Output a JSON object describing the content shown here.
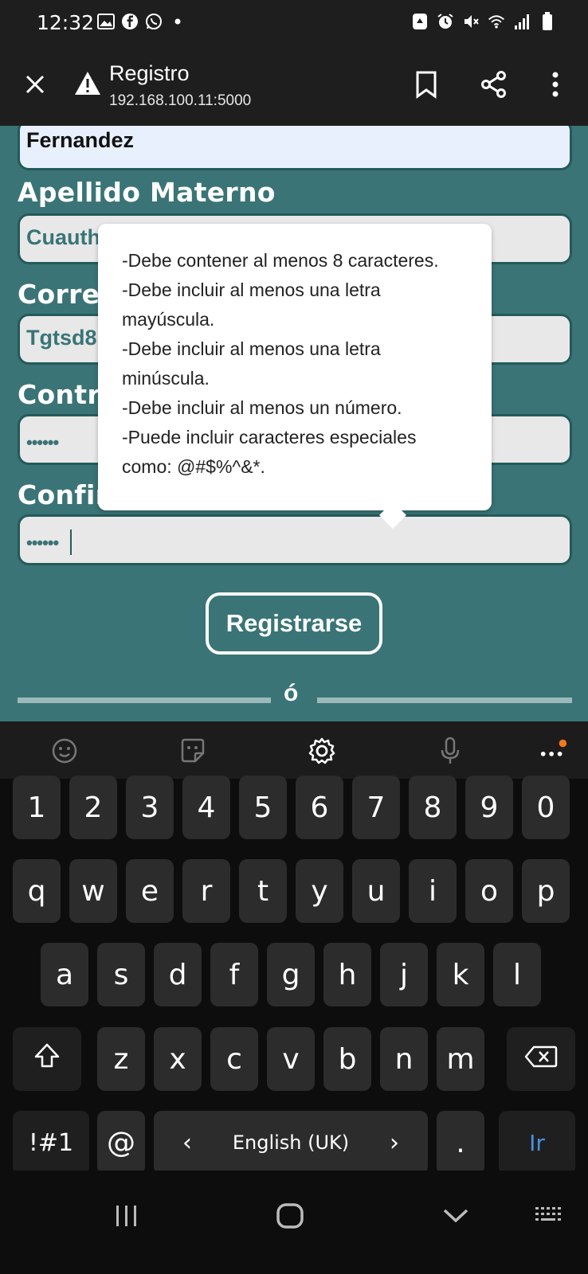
{
  "status_bar": {
    "time": "12:32",
    "left_icons": [
      "gallery-icon",
      "facebook-icon",
      "whatsapp-icon",
      "dot-icon"
    ],
    "right_icons": [
      "recycle-icon",
      "alarm-icon",
      "mute-icon",
      "wifi-icon",
      "signal-icon",
      "battery-icon"
    ]
  },
  "browser": {
    "title": "Registro",
    "url": "192.168.100.11:5000"
  },
  "form": {
    "paterno_value": "Fernandez",
    "materno_label": "Apellido Materno",
    "materno_value": "Cuauth",
    "correo_label": "Corre",
    "correo_value": "Tgtsd8",
    "password_label": "Contr",
    "password_value": "••••••",
    "confirm_label": "Confirmar Contraseña",
    "confirm_value": "••••••",
    "register_button": "Registrarse",
    "divider_text": "ó"
  },
  "tooltip": {
    "lines": [
      "-Debe contener al menos 8 caracteres.",
      "-Debe incluir al menos una letra mayúscula.",
      "-Debe incluir al menos una letra minúscula.",
      "-Debe incluir al menos un número.",
      "-Puede incluir caracteres especiales como: @#$%^&*."
    ]
  },
  "keyboard": {
    "toolbar_icons": [
      "emoji-icon",
      "sticker-icon",
      "settings-icon",
      "mic-icon",
      "more-icon"
    ],
    "row_numbers": [
      "1",
      "2",
      "3",
      "4",
      "5",
      "6",
      "7",
      "8",
      "9",
      "0"
    ],
    "row1": [
      "q",
      "w",
      "e",
      "r",
      "t",
      "y",
      "u",
      "i",
      "o",
      "p"
    ],
    "row2": [
      "a",
      "s",
      "d",
      "f",
      "g",
      "h",
      "j",
      "k",
      "l"
    ],
    "row3": [
      "z",
      "x",
      "c",
      "v",
      "b",
      "n",
      "m"
    ],
    "symbols_key": "!#1",
    "at_key": "@",
    "space_label": "English (UK)",
    "space_left_arrow": "‹",
    "space_right_arrow": "›",
    "period_key": ".",
    "enter_key": "Ir",
    "accent_color": "#4a90e2"
  },
  "colors": {
    "page_bg": "#3a7476",
    "field_border": "#245a5a"
  }
}
